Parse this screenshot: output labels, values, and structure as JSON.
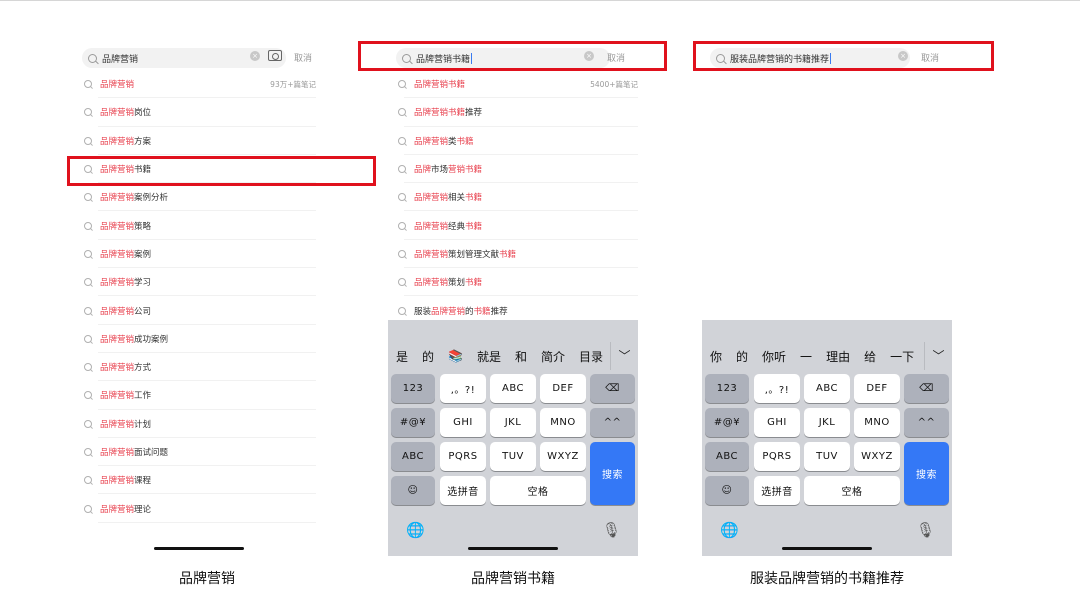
{
  "panel1": {
    "search": {
      "value": "品牌营销",
      "cancel": "取消",
      "icons": [
        "search-icon",
        "clear-icon",
        "camera-icon"
      ]
    },
    "suggestions": [
      {
        "red": "品牌营销",
        "rest": "",
        "count": "93万+篇笔记"
      },
      {
        "red": "品牌营销",
        "rest": "岗位"
      },
      {
        "red": "品牌营销",
        "rest": "方案"
      },
      {
        "red": "品牌营销",
        "rest": "书籍"
      },
      {
        "red": "品牌营销",
        "rest": "案例分析"
      },
      {
        "red": "品牌营销",
        "rest": "策略"
      },
      {
        "red": "品牌营销",
        "rest": "案例"
      },
      {
        "red": "品牌营销",
        "rest": "学习"
      },
      {
        "red": "品牌营销",
        "rest": "公司"
      },
      {
        "red": "品牌营销",
        "rest": "成功案例"
      },
      {
        "red": "品牌营销",
        "rest": "方式"
      },
      {
        "red": "品牌营销",
        "rest": "工作"
      },
      {
        "red": "品牌营销",
        "rest": "计划"
      },
      {
        "red": "品牌营销",
        "rest": "面试问题"
      },
      {
        "red": "品牌营销",
        "rest": "课程"
      },
      {
        "red": "品牌营销",
        "rest": "理论"
      }
    ],
    "caption": "品牌营销"
  },
  "panel2": {
    "search": {
      "value": "品牌营销书籍",
      "cancel": "取消"
    },
    "suggestions": [
      {
        "segs": [
          {
            "t": "品牌营销书籍",
            "red": true
          }
        ],
        "count": "5400+篇笔记"
      },
      {
        "segs": [
          {
            "t": "品牌营销书籍",
            "red": true
          },
          {
            "t": "推荐",
            "red": false
          }
        ]
      },
      {
        "segs": [
          {
            "t": "品牌营销",
            "red": true
          },
          {
            "t": "类",
            "red": false
          },
          {
            "t": "书籍",
            "red": true
          }
        ]
      },
      {
        "segs": [
          {
            "t": "品牌",
            "red": true
          },
          {
            "t": "市场",
            "red": false
          },
          {
            "t": "营销书籍",
            "red": true
          }
        ]
      },
      {
        "segs": [
          {
            "t": "品牌营销",
            "red": true
          },
          {
            "t": "相关",
            "red": false
          },
          {
            "t": "书籍",
            "red": true
          }
        ]
      },
      {
        "segs": [
          {
            "t": "品牌营销",
            "red": true
          },
          {
            "t": "经典",
            "red": false
          },
          {
            "t": "书籍",
            "red": true
          }
        ]
      },
      {
        "segs": [
          {
            "t": "品牌营销",
            "red": true
          },
          {
            "t": "策划管理文献",
            "red": false
          },
          {
            "t": "书籍",
            "red": true
          }
        ]
      },
      {
        "segs": [
          {
            "t": "品牌营销",
            "red": true
          },
          {
            "t": "策划",
            "red": false
          },
          {
            "t": "书籍",
            "red": true
          }
        ]
      },
      {
        "segs": [
          {
            "t": "服装",
            "red": false
          },
          {
            "t": "品牌营销",
            "red": true
          },
          {
            "t": "的",
            "red": false
          },
          {
            "t": "书籍",
            "red": true
          },
          {
            "t": "推荐",
            "red": false
          }
        ]
      }
    ],
    "keyboard": {
      "candidates": [
        "是",
        "的",
        "📚",
        "就是",
        "和",
        "简介",
        "目录"
      ],
      "chevron": "﹀"
    },
    "caption": "品牌营销书籍"
  },
  "panel3": {
    "search": {
      "value": "服装品牌营销的书籍推荐",
      "cancel": "取消"
    },
    "keyboard": {
      "candidates": [
        "你",
        "的",
        "你听",
        "一",
        "理由",
        "给",
        "一下"
      ],
      "chevron": "﹀"
    },
    "caption": "服装品牌营销的书籍推荐"
  },
  "keys": {
    "k123": "123",
    "punct": ",。?!",
    "abc": "ABC",
    "def": "DEF",
    "backspace": "⌫",
    "sym": "#@¥",
    "ghi": "GHI",
    "jkl": "JKL",
    "mno": "MNO",
    "caret": "^^",
    "abcmode": "ABC",
    "pqrs": "PQRS",
    "tuv": "TUV",
    "wxyz": "WXYZ",
    "search": "搜索",
    "emoji": "☺",
    "pinyin": "选拼音",
    "space": "空格",
    "globe": "🌐",
    "mic": "🎙"
  }
}
